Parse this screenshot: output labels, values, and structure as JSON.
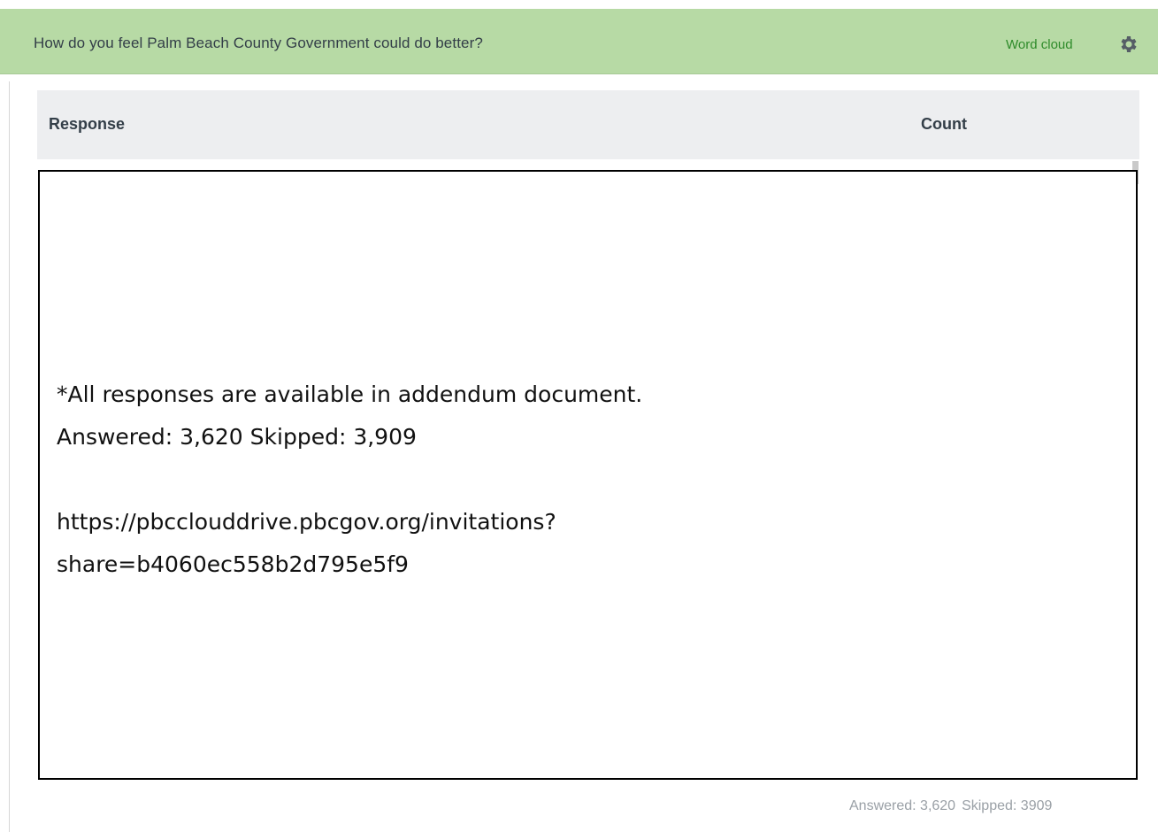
{
  "header": {
    "question": "How do you feel Palm Beach County Government could do better?",
    "word_cloud_label": "Word cloud",
    "settings_icon": "gear-icon",
    "background_color": "#b7daa5",
    "link_color": "#2e8b2a"
  },
  "table": {
    "columns": [
      "Response",
      "Count"
    ]
  },
  "overlay": {
    "note": "*All responses are available in addendum document.",
    "stats": "Answered: 3,620 Skipped: 3,909",
    "link_line1": "https://pbcclouddrive.pbcgov.org/invitations?",
    "link_line2": "share=b4060ec558b2d795e5f9"
  },
  "footer": {
    "answered": "Answered: 3,620",
    "skipped": "Skipped: 3909"
  }
}
